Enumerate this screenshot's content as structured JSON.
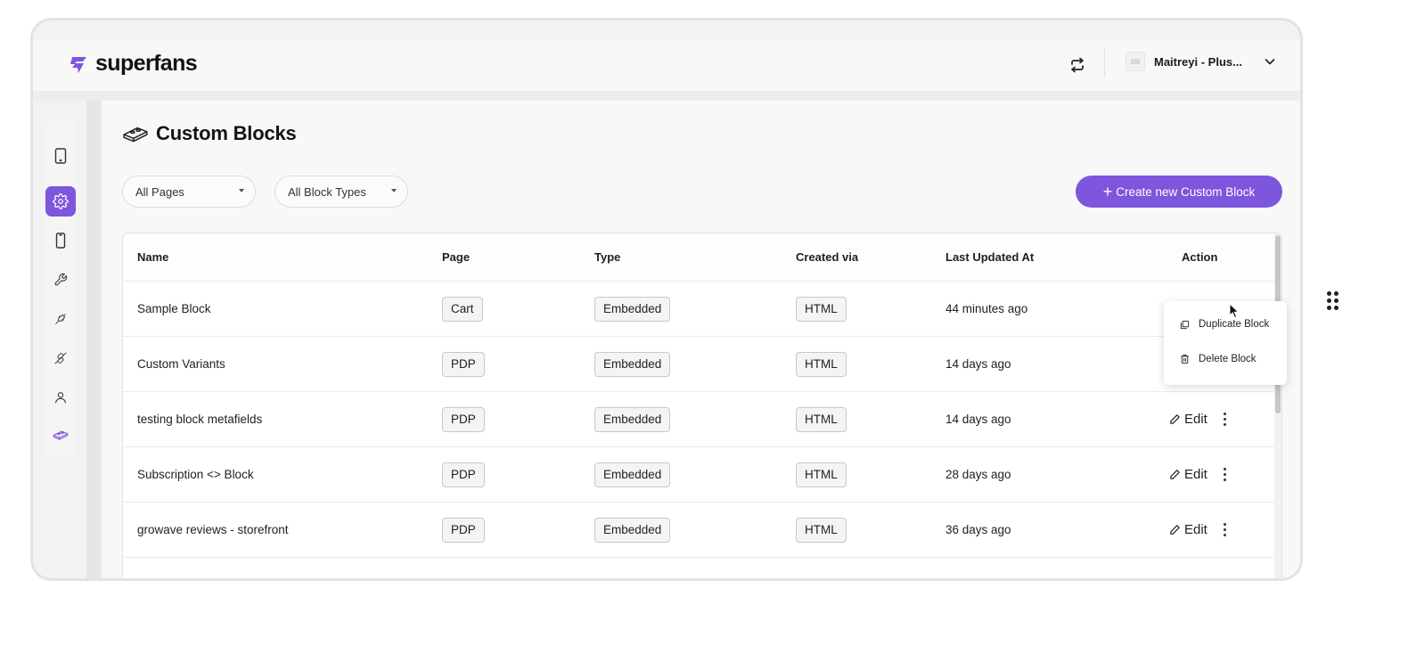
{
  "brand": {
    "name": "superfans",
    "accent": "#7e55dd"
  },
  "header": {
    "account_name": "Maitreyi - Plus..."
  },
  "sidebar": {
    "items": [
      {
        "icon": "tablet-icon",
        "active": false
      },
      {
        "icon": "gear-icon",
        "active": true
      },
      {
        "icon": "phone-icon",
        "active": false
      },
      {
        "icon": "wrench-icon",
        "active": false
      },
      {
        "icon": "plug-icon",
        "active": false
      },
      {
        "icon": "plug-connect-icon",
        "active": false
      },
      {
        "icon": "user-icon",
        "active": false
      },
      {
        "icon": "blocks-icon",
        "active": false
      }
    ]
  },
  "page": {
    "title": "Custom Blocks",
    "title_icon": "blocks-icon"
  },
  "filters": {
    "pages": {
      "selected": "All Pages"
    },
    "block_types": {
      "selected": "All Block Types"
    }
  },
  "actions": {
    "create_label": "Create new Custom Block",
    "create_icon": "+"
  },
  "table": {
    "headers": {
      "name": "Name",
      "page": "Page",
      "type": "Type",
      "created_via": "Created via",
      "last_updated": "Last Updated At",
      "action": "Action"
    },
    "edit_label": "Edit",
    "rows": [
      {
        "name": "Sample Block",
        "page": "Cart",
        "type": "Embedded",
        "created_via": "HTML",
        "last_updated": "44 minutes ago"
      },
      {
        "name": "Custom Variants",
        "page": "PDP",
        "type": "Embedded",
        "created_via": "HTML",
        "last_updated": "14 days ago"
      },
      {
        "name": "testing block metafields",
        "page": "PDP",
        "type": "Embedded",
        "created_via": "HTML",
        "last_updated": "14 days ago"
      },
      {
        "name": "Subscription <> Block",
        "page": "PDP",
        "type": "Embedded",
        "created_via": "HTML",
        "last_updated": "28 days ago"
      },
      {
        "name": "growave reviews - storefront",
        "page": "PDP",
        "type": "Embedded",
        "created_via": "HTML",
        "last_updated": "36 days ago"
      }
    ]
  },
  "context_menu": {
    "items": [
      {
        "label": "Duplicate Block",
        "icon": "copy-icon"
      },
      {
        "label": "Delete Block",
        "icon": "trash-icon"
      }
    ]
  }
}
